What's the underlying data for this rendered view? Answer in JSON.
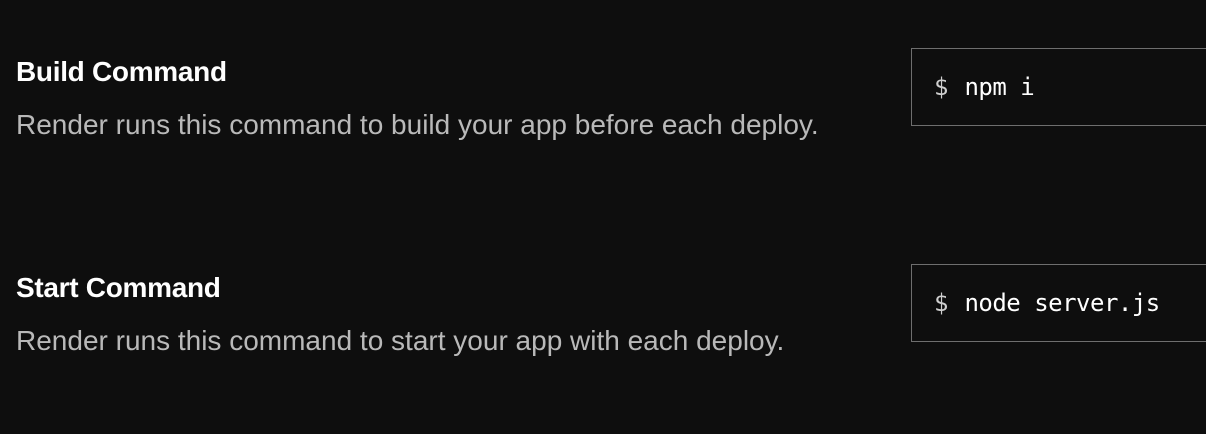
{
  "build": {
    "title": "Build Command",
    "description": "Render runs this command to build your app before each deploy.",
    "prompt": "$",
    "value": "npm i"
  },
  "start": {
    "title": "Start Command",
    "description": "Render runs this command to start your app with each deploy.",
    "prompt": "$",
    "value": "node server.js"
  },
  "colors": {
    "background": "#0e0e0e",
    "title": "#ffffff",
    "description": "#b9b9b9",
    "field_border": "#6e6e6e"
  }
}
